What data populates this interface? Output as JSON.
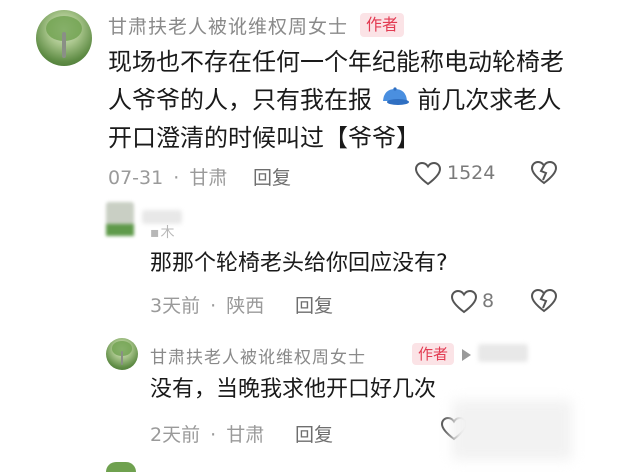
{
  "comments": [
    {
      "author": "甘肃扶老人被讹维权周女士",
      "badge": "作者",
      "lines": [
        "现场也不存在任何一个年纪能称电动轮椅老",
        "人爷爷的人，只有我在报",
        "前几次求老人",
        "开口澄清的时候叫过【爷爷】"
      ],
      "date": "07-31",
      "location": "甘肃",
      "reply": "回复",
      "likes": "1524"
    },
    {
      "author_partial": "▪木",
      "text": "那那个轮椅老头给你回应没有?",
      "date": "3天前",
      "location": "陕西",
      "reply": "回复",
      "likes": "8"
    },
    {
      "author": "甘肃扶老人被讹维权周女士",
      "badge": "作者",
      "text": "没有，当晚我求他开口好几次",
      "date": "2天前",
      "location": "甘肃",
      "reply": "回复"
    }
  ],
  "separator": "·",
  "colors": {
    "badge_bg": "#fbe3e6",
    "badge_fg": "#e23b52",
    "name": "#8a8a8a",
    "meta": "#9a9a9a"
  },
  "icons": [
    "heart-icon",
    "broken-heart-icon",
    "cap-emoji-icon",
    "triangle-icon"
  ]
}
